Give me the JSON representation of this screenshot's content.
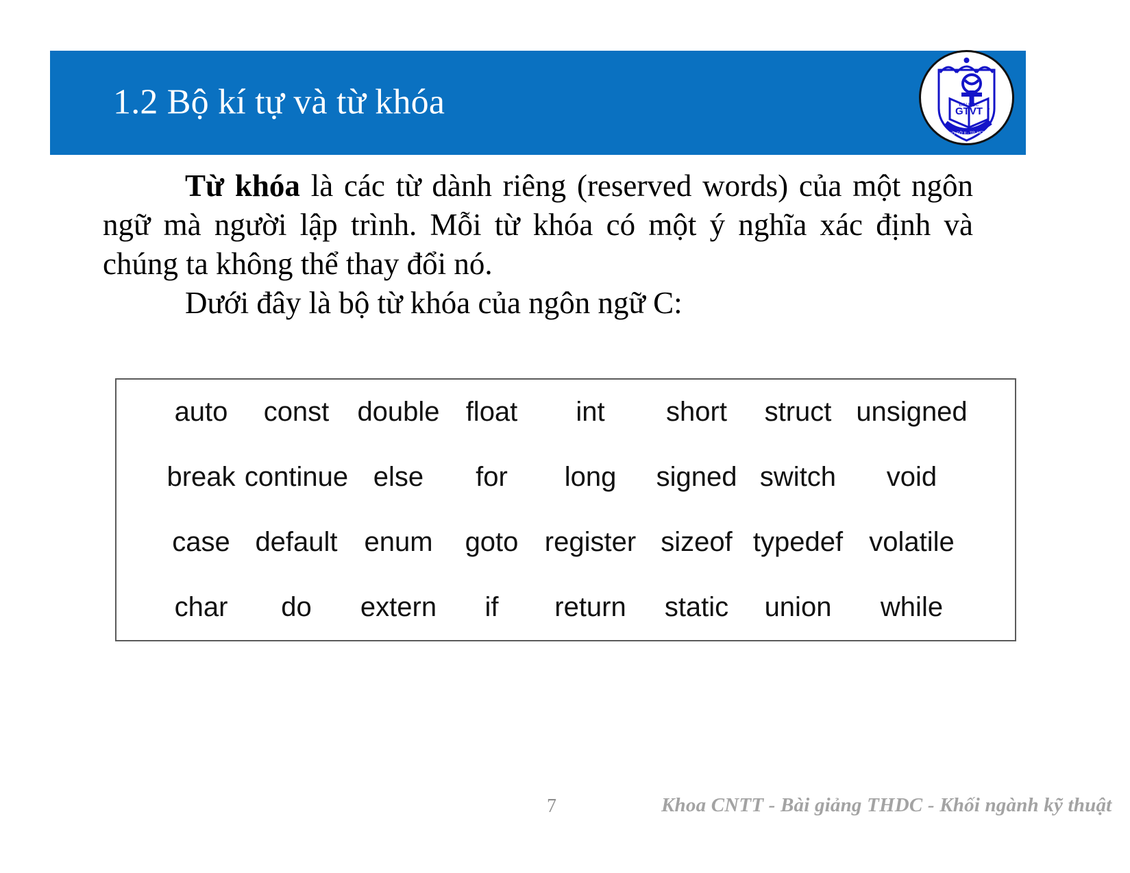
{
  "slide": {
    "title": "1.2 Bộ kí tự và từ khóa",
    "header_color": "#0a71c1",
    "logo": {
      "name": "university-emblem",
      "text_top": "ĐẠI HỌC",
      "text_main": "GTVT",
      "ribbon_text": "CƠ SỞ II - TP. HCM",
      "color": "#1414c8"
    }
  },
  "body": {
    "paragraph_1_lead": "Từ khóa",
    "paragraph_1_rest": " là các từ dành riêng (reserved words) của một ngôn ngữ mà người lập trình. Mỗi từ khóa có một ý nghĩa xác định và chúng ta không thể thay đổi nó.",
    "paragraph_2": "Dưới đây là bộ từ khóa của ngôn ngữ C:"
  },
  "keyword_table": {
    "border_color": "#5a5a5a",
    "rows": [
      [
        "auto",
        "const",
        "double",
        "float",
        "int",
        "short",
        "struct",
        "unsigned"
      ],
      [
        "break",
        "continue",
        "else",
        "for",
        "long",
        "signed",
        "switch",
        "void"
      ],
      [
        "case",
        "default",
        "enum",
        "goto",
        "register",
        "sizeof",
        "typedef",
        "volatile"
      ],
      [
        "char",
        "do",
        "extern",
        "if",
        "return",
        "static",
        "union",
        "while"
      ]
    ]
  },
  "footer": {
    "page_number": "7",
    "note": "Khoa CNTT - Bài giảng THDC - Khối ngành kỹ thuật"
  }
}
